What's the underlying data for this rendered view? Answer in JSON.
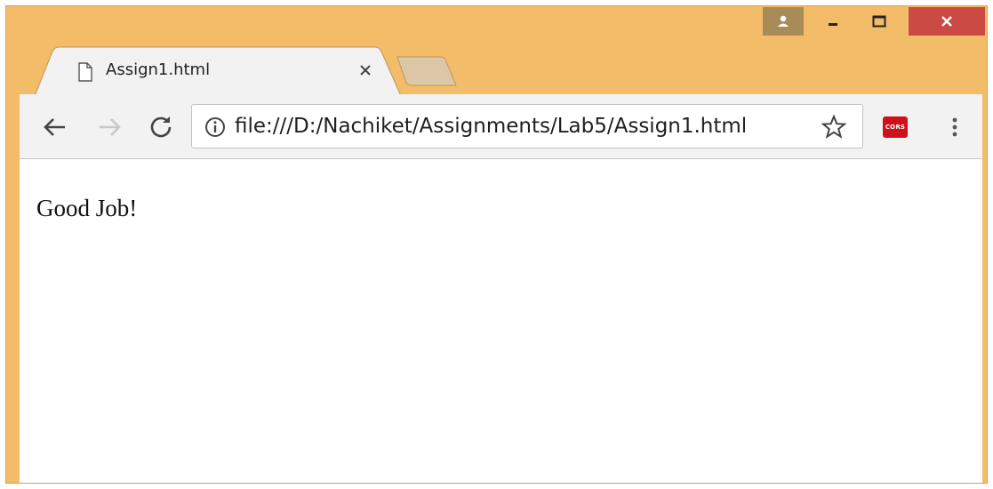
{
  "window": {
    "accent_color": "#f2bc68",
    "close_color": "#cc4a44",
    "profile_color": "#a98b58"
  },
  "tab": {
    "title": "Assign1.html",
    "icon": "document-icon"
  },
  "toolbar": {
    "url": "file:///D:/Nachiket/Assignments/Lab5/Assign1.html",
    "extension_label": "CORS"
  },
  "page": {
    "text": "Good Job!"
  }
}
